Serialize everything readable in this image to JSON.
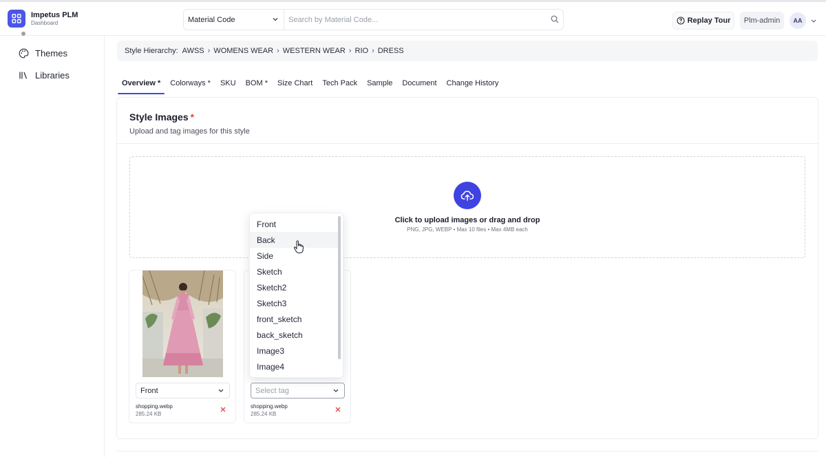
{
  "app": {
    "title": "Impetus PLM",
    "subtitle": "Dashboard"
  },
  "search": {
    "type_selected": "Material Code",
    "placeholder": "Search by Material Code..."
  },
  "header": {
    "replay_tour": "Replay Tour",
    "role": "Plm-admin",
    "avatar_initials": "AA"
  },
  "sidebar": {
    "items": [
      {
        "label": "Themes",
        "icon": "palette-icon"
      },
      {
        "label": "Libraries",
        "icon": "library-icon"
      }
    ]
  },
  "breadcrumb": {
    "label": "Style Hierarchy:",
    "items": [
      "AWSS",
      "WOMENS WEAR",
      "WESTERN WEAR",
      "RIO",
      "DRESS"
    ]
  },
  "tabs": [
    "Overview *",
    "Colorways *",
    "SKU",
    "BOM *",
    "Size Chart",
    "Tech Pack",
    "Sample",
    "Document",
    "Change History"
  ],
  "style_images": {
    "title": "Style Images",
    "required_mark": "*",
    "subtitle": "Upload and tag images for this style",
    "upload_text": "Click to upload images or drag and drop",
    "upload_hint": "PNG, JPG, WEBP • Max 10 files • Max 4MB each"
  },
  "images": [
    {
      "tag": "Front",
      "file_name": "shopping.webp",
      "file_size": "285.24 KB"
    },
    {
      "tag_placeholder": "Select tag",
      "file_name": "shopping.webp",
      "file_size": "285.24 KB"
    }
  ],
  "tag_options": [
    "Front",
    "Back",
    "Side",
    "Sketch",
    "Sketch2",
    "Sketch3",
    "front_sketch",
    "back_sketch",
    "Image3",
    "Image4"
  ],
  "colors": {
    "accent": "#3f43e0",
    "logo": "#4b55e8",
    "danger": "#e24848"
  }
}
